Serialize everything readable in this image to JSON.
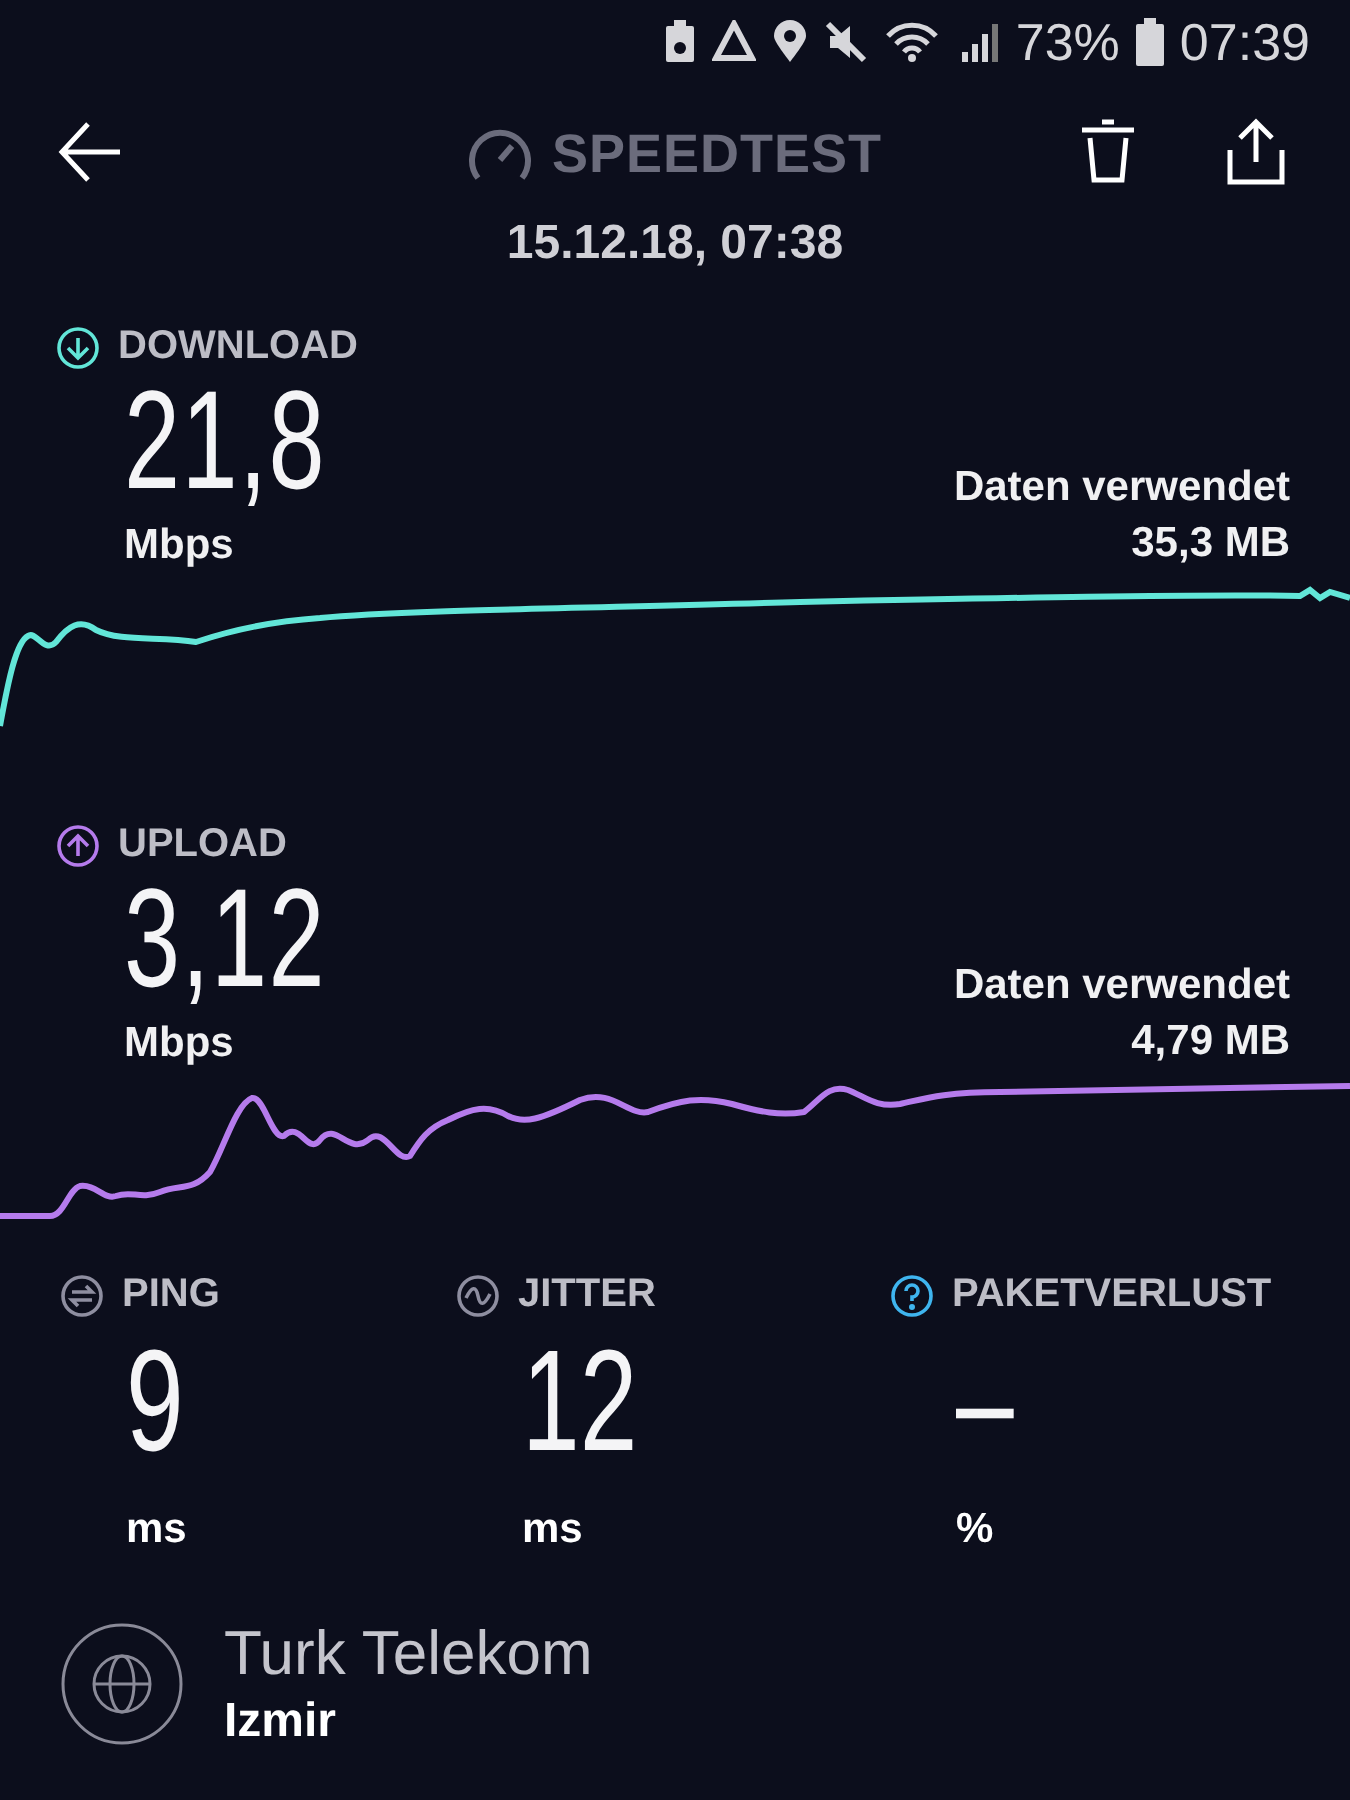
{
  "status_bar": {
    "battery": "73%",
    "time": "07:39"
  },
  "header": {
    "title": "SPEEDTEST",
    "date": "15.12.18, 07:38"
  },
  "results": [
    {
      "kind": "download",
      "label": "DOWNLOAD",
      "value": "21,8",
      "unit": "Mbps",
      "data_label": "Daten verwendet",
      "data_value": "35,3 MB"
    },
    {
      "kind": "upload",
      "label": "UPLOAD",
      "value": "3,12",
      "unit": "Mbps",
      "data_label": "Daten verwendet",
      "data_value": "4,79 MB"
    }
  ],
  "metrics": [
    {
      "kind": "ping",
      "label": "PING",
      "value": "9",
      "unit": "ms"
    },
    {
      "kind": "jitter",
      "label": "JITTER",
      "value": "12",
      "unit": "ms"
    },
    {
      "kind": "loss",
      "label": "PAKETVERLUST",
      "value": "–",
      "unit": "%"
    }
  ],
  "server": {
    "provider": "Turk Telekom",
    "location": "Izmir"
  }
}
